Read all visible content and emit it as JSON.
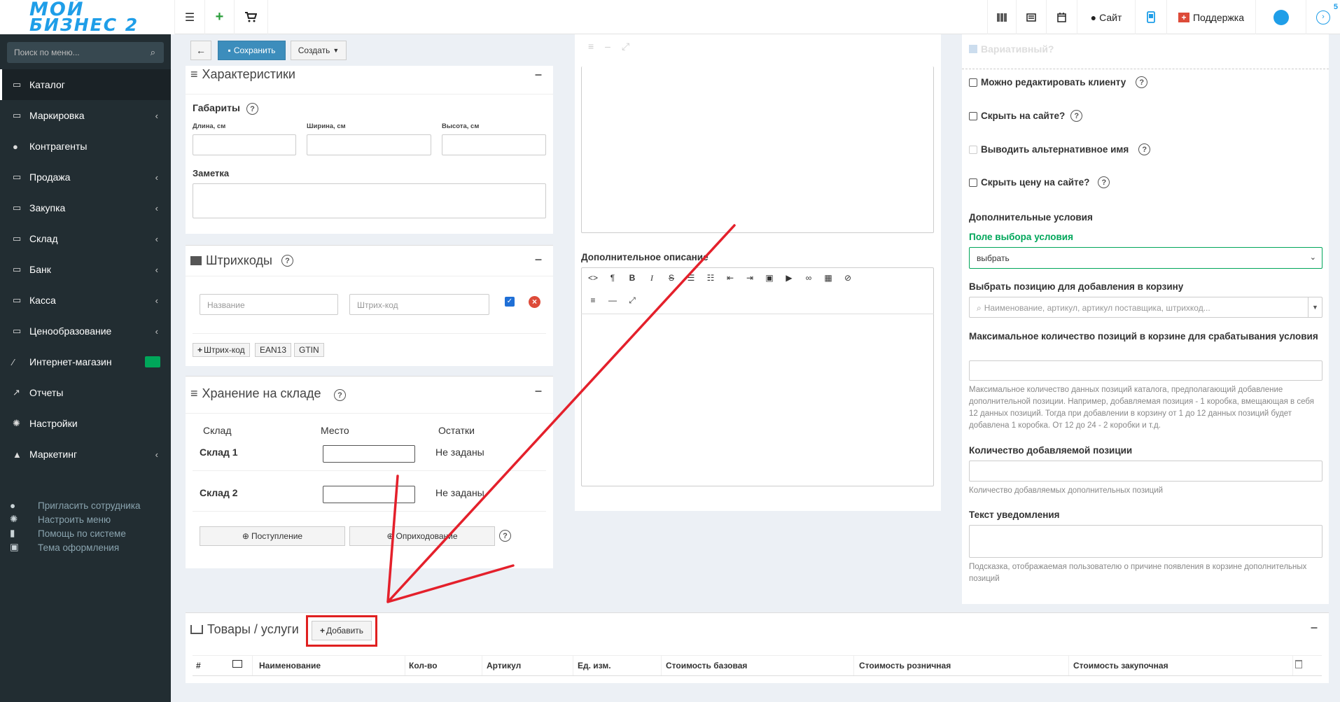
{
  "header": {
    "logo_top": "МОЙ",
    "logo_bottom": "БИЗНЕС 2",
    "site_label": "Сайт",
    "support_label": "Поддержка",
    "notify_count": "5"
  },
  "sidebar": {
    "search_placeholder": "Поиск по меню...",
    "items": [
      {
        "label": "Каталог"
      },
      {
        "label": "Маркировка"
      },
      {
        "label": "Контрагенты"
      },
      {
        "label": "Продажа"
      },
      {
        "label": "Закупка"
      },
      {
        "label": "Склад"
      },
      {
        "label": "Банк"
      },
      {
        "label": "Касса"
      },
      {
        "label": "Ценообразование"
      },
      {
        "label": "Интернет-магазин"
      },
      {
        "label": "Отчеты"
      },
      {
        "label": "Настройки"
      },
      {
        "label": "Маркетинг"
      }
    ],
    "footer": [
      {
        "label": "Пригласить сотрудника"
      },
      {
        "label": "Настроить меню"
      },
      {
        "label": "Помощь по системе"
      },
      {
        "label": "Тема оформления"
      }
    ]
  },
  "toolbar": {
    "save_label": "Сохранить",
    "create_label": "Создать"
  },
  "characteristics": {
    "title": "Характеристики",
    "dimensions_label": "Габариты",
    "length_label": "Длина, см",
    "width_label": "Ширина, см",
    "height_label": "Высота, см",
    "note_label": "Заметка"
  },
  "barcodes": {
    "title": "Штрихкоды",
    "name_placeholder": "Название",
    "code_placeholder": "Штрих-код",
    "add_label": "Штрих-код",
    "ean13": "EAN13",
    "gtin": "GTIN"
  },
  "storage": {
    "title": "Хранение на складе",
    "col_warehouse": "Склад",
    "col_place": "Место",
    "col_stock": "Остатки",
    "rows": [
      {
        "name": "Склад 1",
        "stock": "Не заданы"
      },
      {
        "name": "Склад 2",
        "stock": "Не заданы"
      }
    ],
    "receipt_label": "Поступление",
    "writeoff_label": "Оприходование"
  },
  "description": {
    "extra_label": "Дополнительное описание"
  },
  "options": {
    "variative_label": "Вариативный?",
    "editable_label": "Можно редактировать клиенту",
    "hide_site_label": "Скрыть на сайте?",
    "alt_name_label": "Выводить альтернативное имя",
    "hide_price_label": "Скрыть цену на сайте?",
    "extra_conditions_label": "Дополнительные условия",
    "condition_field_label": "Поле выбора условия",
    "condition_select_value": "выбрать",
    "position_label": "Выбрать позицию для добавления в корзину",
    "position_placeholder": "Наименование, артикул, артикул поставщика, штрихкод...",
    "max_qty_label": "Максимальное количество позиций в корзине для срабатывания условия",
    "max_qty_hint": "Максимальное количество данных позиций каталога, предполагающий добавление дополнительной позиции. Например, добавляемая позиция - 1 коробка, вмещающая в себя 12 данных позиций. Тогда при добавлении в корзину от 1 до 12 данных позиций будет добавлена 1 коробка. От 12 до 24 - 2 коробки и т.д.",
    "add_qty_label": "Количество добавляемой позиции",
    "add_qty_hint": "Количество добавляемых дополнительных позиций",
    "notify_text_label": "Текст уведомления",
    "notify_text_hint": "Подсказка, отображаемая пользователю о причине появления в корзине дополнительных позиций"
  },
  "goods": {
    "title": "Товары / услуги",
    "add_label": "Добавить",
    "columns": [
      "#",
      "Наименование",
      "Кол-во",
      "Артикул",
      "Ед. изм.",
      "Стоимость базовая",
      "Стоимость розничная",
      "Стоимость закупочная"
    ]
  }
}
